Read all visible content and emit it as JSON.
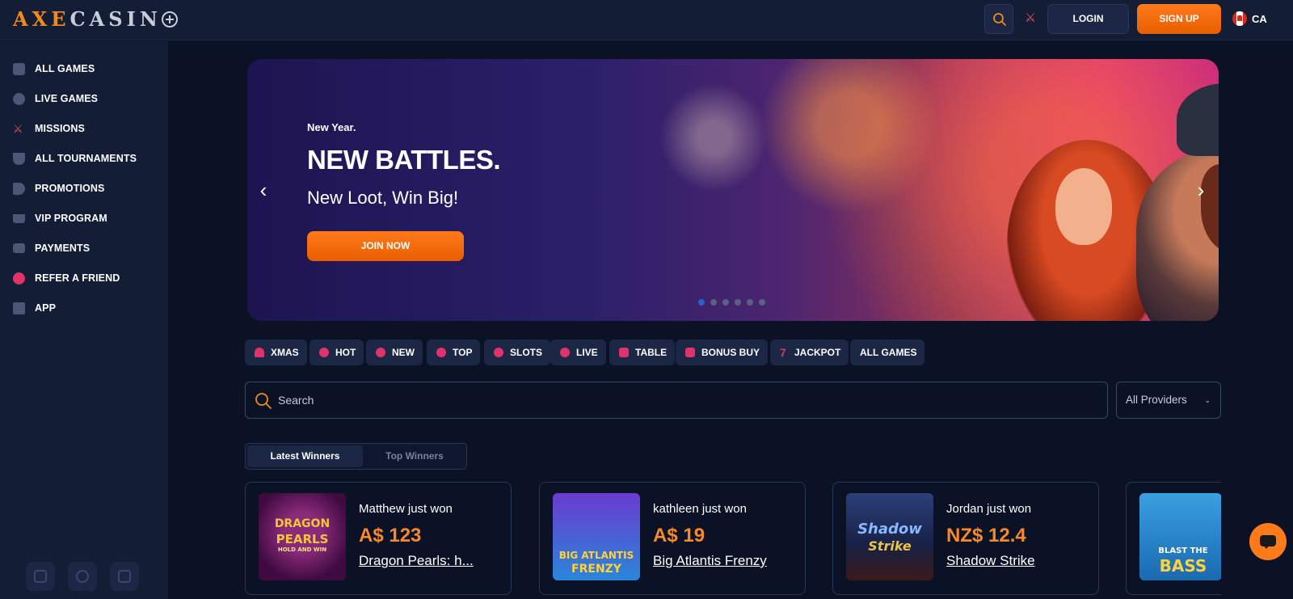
{
  "header": {
    "logo_axe": "AXE",
    "logo_casino": "CASIN",
    "search_icon": "search-icon",
    "missions_icon": "missions-icon",
    "login_label": "LOGIN",
    "signup_label": "SIGN UP",
    "lang": "CA",
    "accent_color": "#ff7a1a"
  },
  "sidebar": {
    "items": [
      {
        "label": "ALL GAMES",
        "icon": "all-games-icon"
      },
      {
        "label": "LIVE GAMES",
        "icon": "live-games-icon"
      },
      {
        "label": "MISSIONS",
        "icon": "missions-icon"
      },
      {
        "label": "ALL TOURNAMENTS",
        "icon": "trophy-icon"
      },
      {
        "label": "PROMOTIONS",
        "icon": "megaphone-icon"
      },
      {
        "label": "VIP PROGRAM",
        "icon": "crown-icon"
      },
      {
        "label": "PAYMENTS",
        "icon": "wallet-icon"
      },
      {
        "label": "REFER A FRIEND",
        "icon": "users-icon"
      },
      {
        "label": "APP",
        "icon": "app-grid-icon"
      }
    ],
    "social": [
      "instagram-icon",
      "telegram-icon",
      "facebook-icon"
    ]
  },
  "banner": {
    "kicker": "New Year.",
    "title": "NEW BATTLES.",
    "subtitle": "New Loot, Win Big!",
    "cta": "JOIN NOW",
    "slide_count": 6,
    "active_slide": 1
  },
  "categories": [
    {
      "label": "XMAS",
      "icon": "tree-icon"
    },
    {
      "label": "HOT",
      "icon": "flame-icon"
    },
    {
      "label": "NEW",
      "icon": "new-icon"
    },
    {
      "label": "TOP",
      "icon": "top-icon"
    },
    {
      "label": "SLOTS",
      "icon": "cherry-icon"
    },
    {
      "label": "LIVE",
      "icon": "live-icon"
    },
    {
      "label": "TABLE",
      "icon": "table-icon"
    },
    {
      "label": "BONUS BUY",
      "icon": "gift-icon"
    },
    {
      "label": "JACKPOT",
      "icon": "seven-icon"
    },
    {
      "label": "ALL GAMES",
      "icon": ""
    }
  ],
  "search": {
    "placeholder": "Search",
    "providers": "All Providers"
  },
  "winners_tabs": {
    "active": "Latest Winners",
    "inactive": "Top Winners"
  },
  "winners": [
    {
      "name": "Matthew just won",
      "amount": "A$ 123",
      "game": "Dragon Pearls: h..."
    },
    {
      "name": "kathleen just won",
      "amount": "A$ 19",
      "game": "Big Atlantis Frenzy"
    },
    {
      "name": "Jordan just won",
      "amount": "NZ$ 12.4",
      "game": "Shadow Strike"
    }
  ],
  "thumbs": {
    "dragon_line1": "DRAGON",
    "dragon_line2": "PEARLS",
    "dragon_line3": "HOLD AND WIN",
    "atlantis_line1": "BIG ATLANTIS",
    "atlantis_line2": "FRENZY",
    "shadow_line1": "Shadow",
    "shadow_line2": "Strike",
    "bass_line1": "BLAST THE",
    "bass_line2": "BASS"
  },
  "chat_icon": "chat-icon"
}
